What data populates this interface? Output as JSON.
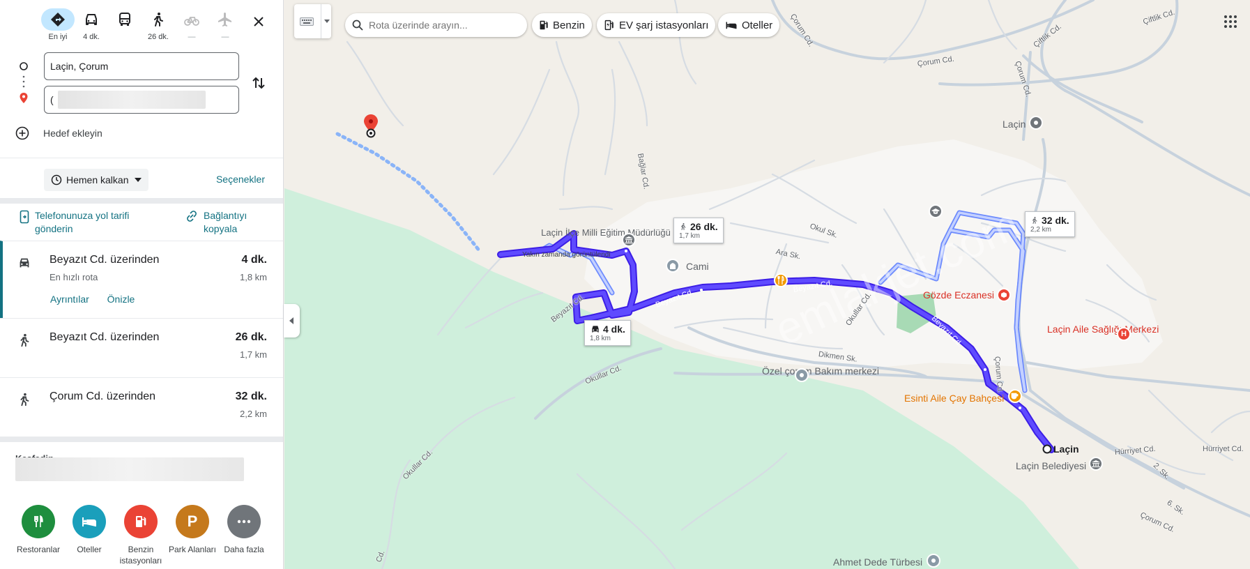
{
  "modes": [
    {
      "label": "En iyi",
      "icon": "directions-icon",
      "active": true
    },
    {
      "label": "4 dk.",
      "icon": "car-icon"
    },
    {
      "label": "",
      "icon": "bus-icon"
    },
    {
      "label": "26 dk.",
      "icon": "walk-icon"
    },
    {
      "label": "—",
      "icon": "bicycle-icon"
    },
    {
      "label": "—",
      "icon": "airplane-icon"
    }
  ],
  "origin": {
    "value": "Laçin, Çorum"
  },
  "destination": {
    "value": "("
  },
  "add_destination": "Hedef ekleyin",
  "depart": "Hemen kalkan",
  "options": "Seçenekler",
  "share": {
    "send_to_phone": "Telefonunuza yol tarifi gönderin",
    "copy_link": "Bağlantıyı kopyala"
  },
  "routes": [
    {
      "mode": "car-icon",
      "title": "Beyazıt Cd. üzerinden",
      "subtitle": "En hızlı rota",
      "time": "4 dk.",
      "distance": "1,8 km",
      "details": "Ayrıntılar",
      "preview": "Önizle"
    },
    {
      "mode": "walk-icon",
      "title": "Beyazıt Cd. üzerinden",
      "subtitle": "",
      "time": "26 dk.",
      "distance": "1,7 km"
    },
    {
      "mode": "walk-icon",
      "title": "Çorum Cd. üzerinden",
      "subtitle": "",
      "time": "32 dk.",
      "distance": "2,2 km"
    }
  ],
  "explore": "Keşfedin",
  "nearby": [
    {
      "label": "Restoranlar",
      "color": "#1e8e3e",
      "icon": "restaurant-icon"
    },
    {
      "label": "Oteller",
      "color": "#1a9fbb",
      "icon": "hotel-icon"
    },
    {
      "label": "Benzin istasyonları",
      "color": "#ea4335",
      "icon": "gas-station-icon"
    },
    {
      "label": "Park Alanları",
      "color": "#c5791c",
      "icon": "parking-icon"
    },
    {
      "label": "Daha fazla",
      "color": "#70757a",
      "icon": "more-icon"
    }
  ],
  "search": {
    "placeholder": "Rota üzerinde arayın..."
  },
  "chips": [
    "Benzin",
    "EV şarj istasyonları",
    "Oteller"
  ],
  "map": {
    "callouts": {
      "car": {
        "time": "4 dk.",
        "distance": "1,8 km"
      },
      "walk1": {
        "time": "26 dk.",
        "distance": "1,7 km"
      },
      "walk2": {
        "time": "32 dk.",
        "distance": "2,2 km"
      }
    },
    "places": {
      "lacin_top": "Laçin",
      "egitim": "Laçin İlçe Milli Eğitim Müdürlüğü",
      "yakin": "Yakın zamanda görüntülendi",
      "cami": "Cami",
      "gozde": "Gözde Eczanesi",
      "aile": "Laçin Aile Sağlığı Merkezi",
      "ozel": "Özel çorum Bakım merkezi",
      "esinti": "Esinti Aile Çay Bahçesi",
      "lacin_dot": "Laçin",
      "belediye": "Laçin Belediyesi",
      "ahmet": "Ahmet Dede Türbesi"
    },
    "streets": {
      "corum1": "Çorum Cd.",
      "corum2": "Çorum Cd.",
      "corum3": "Çorum Cd.",
      "corum4": "Çorum Cd.",
      "corum5": "Çorum Cd.",
      "ciftlik1": "Çiftlik Cd.",
      "ciftlik2": "Çiftlik Cd.",
      "baglar": "Bağlar Cd.",
      "okul": "Okul Sk.",
      "ara": "Ara Sk.",
      "beyazit1": "Beyazıt Cd.",
      "beyazit2": "Beyazıt Cd.",
      "beyazit3": "Beyazıt Cd.",
      "beyazit4": "Beyazıt Cd.",
      "okullar1": "Okullar Cd.",
      "okullar2": "Okullar Cd.",
      "okullar3": "Okullar Cd.",
      "dikmen": "Dikmen Sk.",
      "hurriyet1": "Hürriyet Cd.",
      "hurriyet2": "Hürriyet Cd.",
      "sk2": "2. Sk.",
      "sk6": "6. Sk.",
      "cd": "Cd."
    },
    "watermark": "emlakjet.com"
  }
}
